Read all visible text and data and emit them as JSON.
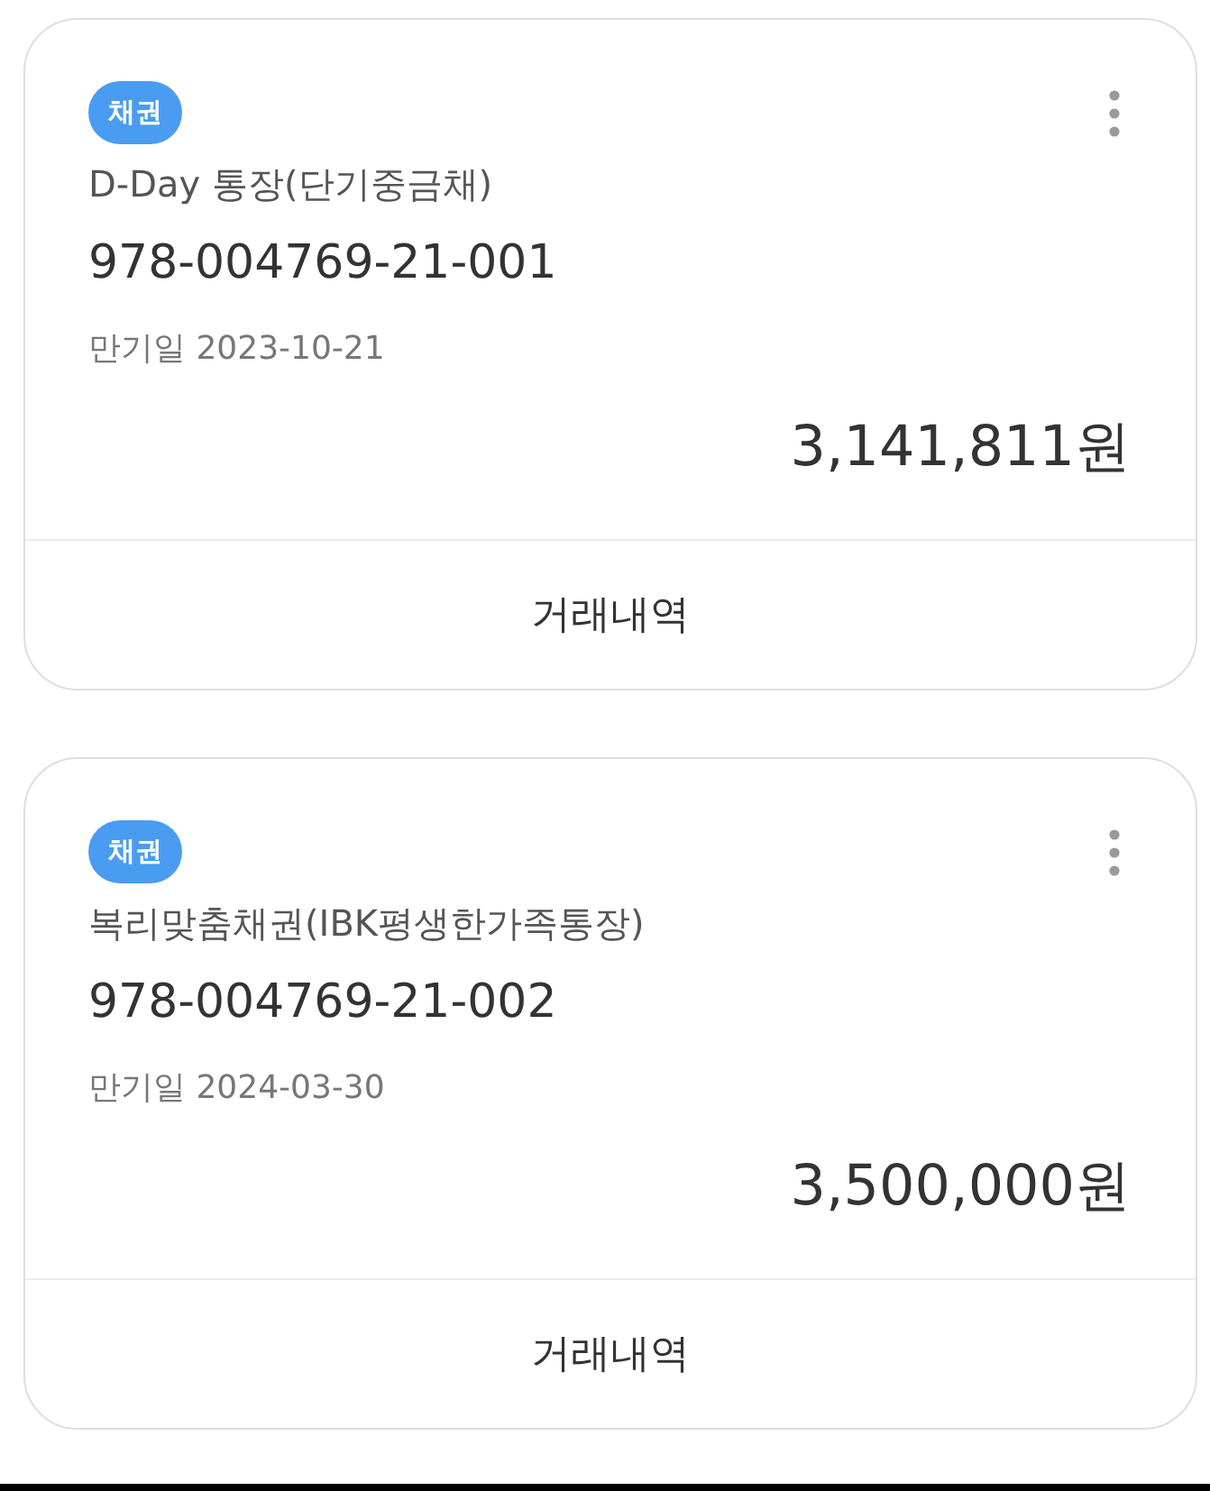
{
  "cards": [
    {
      "badge": "채권",
      "product_name": "D-Day 통장(단기중금채)",
      "account_number": "978-004769-21-001",
      "maturity": "만기일 2023-10-21",
      "amount": "3,141,811원",
      "action": "거래내역"
    },
    {
      "badge": "채권",
      "product_name": "복리맞춤채권(IBK평생한가족통장)",
      "account_number": "978-004769-21-002",
      "maturity": "만기일 2024-03-30",
      "amount": "3,500,000원",
      "action": "거래내역"
    }
  ]
}
